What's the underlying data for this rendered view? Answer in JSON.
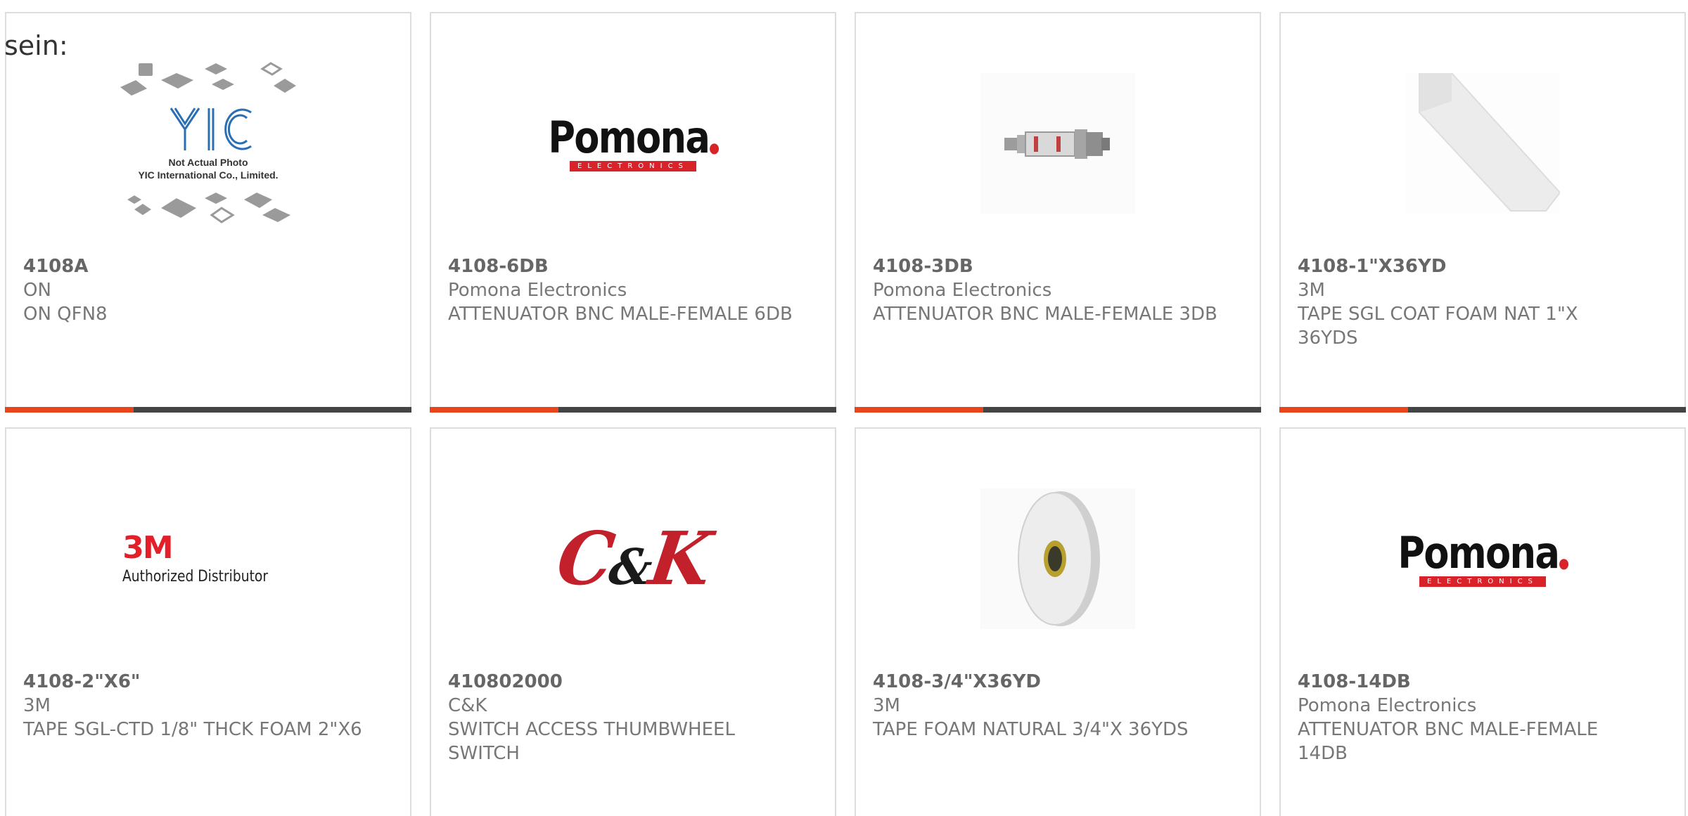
{
  "lead_text": "sein:",
  "products": [
    {
      "part_number": "4108A",
      "manufacturer": "ON",
      "description": "ON QFN8",
      "image_icon": "yic-not-actual-photo",
      "image_text": {
        "brand": "YIC",
        "line1": "Not Actual Photo",
        "line2": "YIC International Co., Limited."
      }
    },
    {
      "part_number": "4108-6DB",
      "manufacturer": "Pomona Electronics",
      "description": "ATTENUATOR BNC MALE-FEMALE 6DB",
      "image_icon": "pomona-logo",
      "image_text": {
        "brand": "Pomona",
        "band": "ELECTRONICS"
      }
    },
    {
      "part_number": "4108-3DB",
      "manufacturer": "Pomona Electronics",
      "description": "ATTENUATOR BNC MALE-FEMALE 3DB",
      "image_icon": "bnc-attenuator-photo"
    },
    {
      "part_number": "4108-1\"X36YD",
      "manufacturer": "3M",
      "description": "TAPE SGL COAT FOAM NAT 1\"X 36YDS",
      "image_icon": "foam-tape-strip-photo"
    },
    {
      "part_number": "4108-2\"X6\"",
      "manufacturer": "3M",
      "description": "TAPE SGL-CTD 1/8\" THCK FOAM 2\"X6",
      "image_icon": "3m-logo",
      "image_text": {
        "brand": "3M",
        "sub": "Authorized Distributor"
      }
    },
    {
      "part_number": "410802000",
      "manufacturer": "C&K",
      "description": "SWITCH ACCESS THUMBWHEEL SWITCH",
      "image_icon": "ck-logo",
      "image_text": {
        "brand_c": "C",
        "brand_amp": "&",
        "brand_k": "K"
      }
    },
    {
      "part_number": "4108-3/4\"X36YD",
      "manufacturer": "3M",
      "description": "TAPE FOAM NATURAL 3/4\"X 36YDS",
      "image_icon": "foam-tape-roll-photo"
    },
    {
      "part_number": "4108-14DB",
      "manufacturer": "Pomona Electronics",
      "description": "ATTENUATOR BNC MALE-FEMALE 14DB",
      "image_icon": "pomona-logo",
      "image_text": {
        "brand": "Pomona",
        "band": "ELECTRONICS"
      }
    }
  ],
  "colors": {
    "accent": "#e8451c",
    "bar": "#444444",
    "border": "#dddddd",
    "text": "#777777",
    "pomona_red": "#d8232a",
    "threem_red": "#e3202a",
    "ck_red": "#c2202a"
  }
}
